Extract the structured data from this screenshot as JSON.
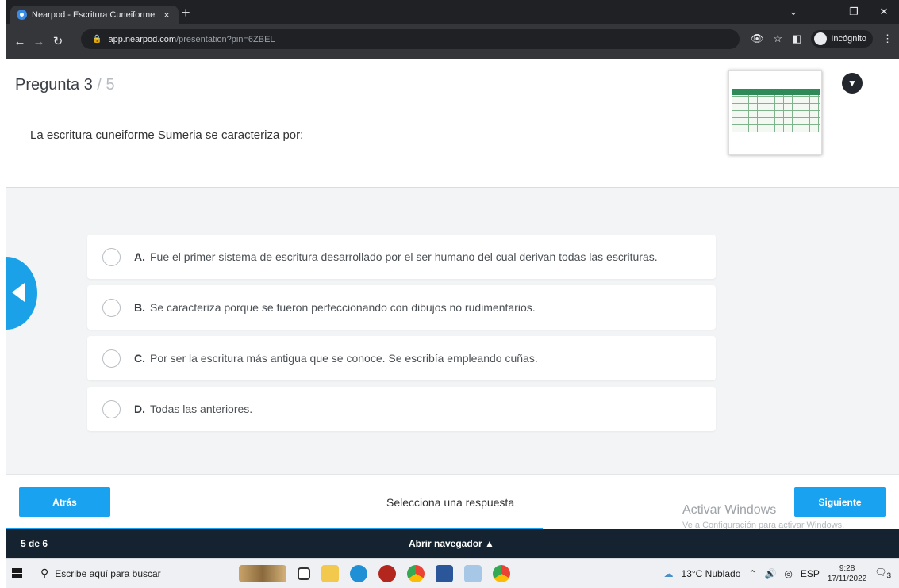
{
  "browser": {
    "tab_title": "Nearpod - Escritura Cuneiforme",
    "tab_close": "×",
    "new_tab": "+",
    "url_host": "app.nearpod.com",
    "url_path": "/presentation?pin=6ZBEL",
    "incognito_label": "Incógnito"
  },
  "question": {
    "label": "Pregunta 3",
    "total": " / 5",
    "text": "La escritura cuneiforme Sumeria se caracteriza por:"
  },
  "options": [
    {
      "letter": "A.",
      "text": "Fue el primer sistema de escritura desarrollado por el ser humano del cual derivan todas las escrituras."
    },
    {
      "letter": "B.",
      "text": "Se caracteriza porque se fueron perfeccionando con dibujos no rudimentarios."
    },
    {
      "letter": "C.",
      "text": "Por ser la escritura más antigua que se conoce. Se escribía empleando cuñas."
    },
    {
      "letter": "D.",
      "text": "Todas las anteriores."
    }
  ],
  "footer": {
    "back_label": "Atrás",
    "prompt": "Selecciona una respuesta",
    "next_label": "Siguiente",
    "watermark_title": "Activar Windows",
    "watermark_sub": "Ve a Configuración para activar Windows."
  },
  "navbar": {
    "count": "5 de 6",
    "open_nav": "Abrir navegador ▲"
  },
  "taskbar": {
    "search_placeholder": "Escribe aquí para buscar",
    "weather": "13°C Nublado",
    "language": "ESP",
    "time": "9:28",
    "date": "17/11/2022",
    "notifications": "3"
  },
  "colors": {
    "accent": "#18a2ef",
    "nav_dark": "#14232f",
    "chrome_dark": "#202124"
  }
}
